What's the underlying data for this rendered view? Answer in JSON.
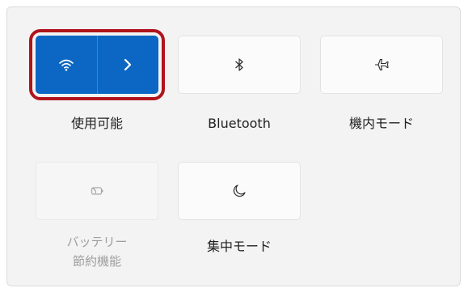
{
  "quick_settings": {
    "wifi": {
      "label": "使用可能",
      "icon": "wifi-icon",
      "expand_icon": "chevron-right-icon",
      "active_color": "#0b67c3"
    },
    "bluetooth": {
      "label": "Bluetooth",
      "icon": "bluetooth-icon"
    },
    "airplane_mode": {
      "label": "機内モード",
      "icon": "airplane-icon"
    },
    "battery_saver": {
      "label_line1": "バッテリー",
      "label_line2": "節約機能",
      "icon": "battery-saver-icon",
      "state": "disabled"
    },
    "focus": {
      "label": "集中モード",
      "icon": "moon-icon"
    }
  },
  "highlight_color": "#b0141c"
}
